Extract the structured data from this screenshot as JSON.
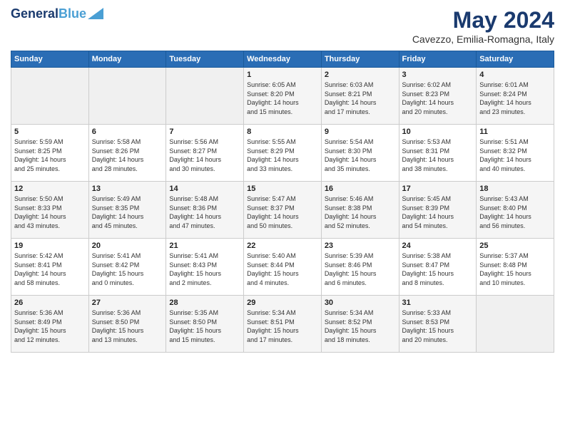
{
  "header": {
    "logo_line1": "General",
    "logo_line2": "Blue",
    "month": "May 2024",
    "location": "Cavezzo, Emilia-Romagna, Italy"
  },
  "days_of_week": [
    "Sunday",
    "Monday",
    "Tuesday",
    "Wednesday",
    "Thursday",
    "Friday",
    "Saturday"
  ],
  "weeks": [
    [
      {
        "day": "",
        "info": ""
      },
      {
        "day": "",
        "info": ""
      },
      {
        "day": "",
        "info": ""
      },
      {
        "day": "1",
        "info": "Sunrise: 6:05 AM\nSunset: 8:20 PM\nDaylight: 14 hours\nand 15 minutes."
      },
      {
        "day": "2",
        "info": "Sunrise: 6:03 AM\nSunset: 8:21 PM\nDaylight: 14 hours\nand 17 minutes."
      },
      {
        "day": "3",
        "info": "Sunrise: 6:02 AM\nSunset: 8:23 PM\nDaylight: 14 hours\nand 20 minutes."
      },
      {
        "day": "4",
        "info": "Sunrise: 6:01 AM\nSunset: 8:24 PM\nDaylight: 14 hours\nand 23 minutes."
      }
    ],
    [
      {
        "day": "5",
        "info": "Sunrise: 5:59 AM\nSunset: 8:25 PM\nDaylight: 14 hours\nand 25 minutes."
      },
      {
        "day": "6",
        "info": "Sunrise: 5:58 AM\nSunset: 8:26 PM\nDaylight: 14 hours\nand 28 minutes."
      },
      {
        "day": "7",
        "info": "Sunrise: 5:56 AM\nSunset: 8:27 PM\nDaylight: 14 hours\nand 30 minutes."
      },
      {
        "day": "8",
        "info": "Sunrise: 5:55 AM\nSunset: 8:29 PM\nDaylight: 14 hours\nand 33 minutes."
      },
      {
        "day": "9",
        "info": "Sunrise: 5:54 AM\nSunset: 8:30 PM\nDaylight: 14 hours\nand 35 minutes."
      },
      {
        "day": "10",
        "info": "Sunrise: 5:53 AM\nSunset: 8:31 PM\nDaylight: 14 hours\nand 38 minutes."
      },
      {
        "day": "11",
        "info": "Sunrise: 5:51 AM\nSunset: 8:32 PM\nDaylight: 14 hours\nand 40 minutes."
      }
    ],
    [
      {
        "day": "12",
        "info": "Sunrise: 5:50 AM\nSunset: 8:33 PM\nDaylight: 14 hours\nand 43 minutes."
      },
      {
        "day": "13",
        "info": "Sunrise: 5:49 AM\nSunset: 8:35 PM\nDaylight: 14 hours\nand 45 minutes."
      },
      {
        "day": "14",
        "info": "Sunrise: 5:48 AM\nSunset: 8:36 PM\nDaylight: 14 hours\nand 47 minutes."
      },
      {
        "day": "15",
        "info": "Sunrise: 5:47 AM\nSunset: 8:37 PM\nDaylight: 14 hours\nand 50 minutes."
      },
      {
        "day": "16",
        "info": "Sunrise: 5:46 AM\nSunset: 8:38 PM\nDaylight: 14 hours\nand 52 minutes."
      },
      {
        "day": "17",
        "info": "Sunrise: 5:45 AM\nSunset: 8:39 PM\nDaylight: 14 hours\nand 54 minutes."
      },
      {
        "day": "18",
        "info": "Sunrise: 5:43 AM\nSunset: 8:40 PM\nDaylight: 14 hours\nand 56 minutes."
      }
    ],
    [
      {
        "day": "19",
        "info": "Sunrise: 5:42 AM\nSunset: 8:41 PM\nDaylight: 14 hours\nand 58 minutes."
      },
      {
        "day": "20",
        "info": "Sunrise: 5:41 AM\nSunset: 8:42 PM\nDaylight: 15 hours\nand 0 minutes."
      },
      {
        "day": "21",
        "info": "Sunrise: 5:41 AM\nSunset: 8:43 PM\nDaylight: 15 hours\nand 2 minutes."
      },
      {
        "day": "22",
        "info": "Sunrise: 5:40 AM\nSunset: 8:44 PM\nDaylight: 15 hours\nand 4 minutes."
      },
      {
        "day": "23",
        "info": "Sunrise: 5:39 AM\nSunset: 8:46 PM\nDaylight: 15 hours\nand 6 minutes."
      },
      {
        "day": "24",
        "info": "Sunrise: 5:38 AM\nSunset: 8:47 PM\nDaylight: 15 hours\nand 8 minutes."
      },
      {
        "day": "25",
        "info": "Sunrise: 5:37 AM\nSunset: 8:48 PM\nDaylight: 15 hours\nand 10 minutes."
      }
    ],
    [
      {
        "day": "26",
        "info": "Sunrise: 5:36 AM\nSunset: 8:49 PM\nDaylight: 15 hours\nand 12 minutes."
      },
      {
        "day": "27",
        "info": "Sunrise: 5:36 AM\nSunset: 8:50 PM\nDaylight: 15 hours\nand 13 minutes."
      },
      {
        "day": "28",
        "info": "Sunrise: 5:35 AM\nSunset: 8:50 PM\nDaylight: 15 hours\nand 15 minutes."
      },
      {
        "day": "29",
        "info": "Sunrise: 5:34 AM\nSunset: 8:51 PM\nDaylight: 15 hours\nand 17 minutes."
      },
      {
        "day": "30",
        "info": "Sunrise: 5:34 AM\nSunset: 8:52 PM\nDaylight: 15 hours\nand 18 minutes."
      },
      {
        "day": "31",
        "info": "Sunrise: 5:33 AM\nSunset: 8:53 PM\nDaylight: 15 hours\nand 20 minutes."
      },
      {
        "day": "",
        "info": ""
      }
    ]
  ]
}
